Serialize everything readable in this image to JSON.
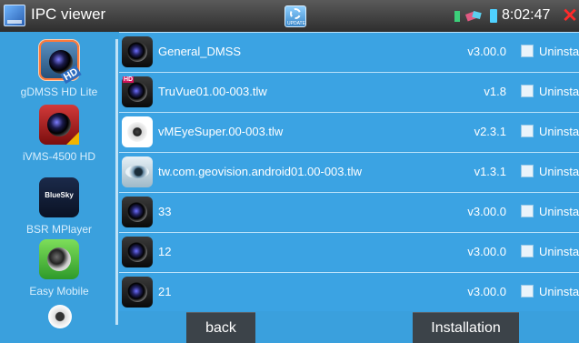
{
  "window": {
    "title": "IPC viewer",
    "update_label": "UPDATE",
    "clock": "8:02:47"
  },
  "sidebar": {
    "items": [
      {
        "label": "gDMSS HD Lite",
        "icon": "gdmss-hd-app-icon",
        "badge": "HD"
      },
      {
        "label": "iVMS-4500 HD",
        "icon": "ivms-app-icon"
      },
      {
        "label": "BSR MPlayer",
        "icon": "bluesky-app-icon",
        "icon_text": "BlueSky"
      },
      {
        "label": "Easy Mobile",
        "icon": "easy-mobile-app-icon"
      },
      {
        "label": "",
        "icon": "webcam-app-icon"
      }
    ]
  },
  "apps": [
    {
      "name": "General_DMSS",
      "version": "v3.00.0",
      "status": "Uninstalled",
      "icon": "dmss-app-icon"
    },
    {
      "name": "TruVue01.00-003.tlw",
      "version": "v1.8",
      "status": "Uninstalled",
      "icon": "truvue-app-icon"
    },
    {
      "name": "vMEyeSuper.00-003.tlw",
      "version": "v2.3.1",
      "status": "Uninstalled",
      "icon": "vmeye-app-icon"
    },
    {
      "name": "tw.com.geovision.android01.00-003.tlw",
      "version": "v1.3.1",
      "status": "Uninstalled",
      "icon": "geovision-app-icon"
    },
    {
      "name": "33",
      "version": "v3.00.0",
      "status": "Uninstalled",
      "icon": "dmss-app-icon"
    },
    {
      "name": "12",
      "version": "v3.00.0",
      "status": "Uninstalled",
      "icon": "dmss-app-icon"
    },
    {
      "name": "21",
      "version": "v3.00.0",
      "status": "Uninstalled",
      "icon": "dmss-app-icon"
    }
  ],
  "buttons": {
    "back": "back",
    "install": "Installation"
  },
  "colors": {
    "background": "#3aa0dd",
    "titlebar": "#3a3a3a",
    "button": "#3c4349",
    "close": "#ff2a2a"
  }
}
